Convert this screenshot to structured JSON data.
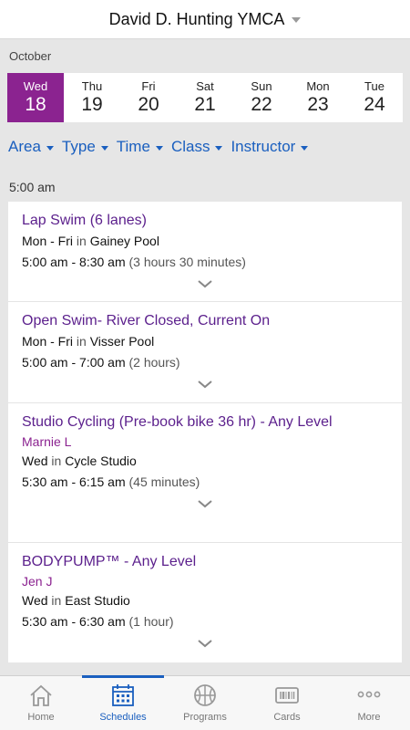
{
  "header": {
    "title": "David D. Hunting YMCA"
  },
  "calendar": {
    "month": "October",
    "days": [
      {
        "name": "Wed",
        "num": "18"
      },
      {
        "name": "Thu",
        "num": "19"
      },
      {
        "name": "Fri",
        "num": "20"
      },
      {
        "name": "Sat",
        "num": "21"
      },
      {
        "name": "Sun",
        "num": "22"
      },
      {
        "name": "Mon",
        "num": "23"
      },
      {
        "name": "Tue",
        "num": "24"
      }
    ],
    "selected_index": 0
  },
  "filters": [
    "Area",
    "Type",
    "Time",
    "Class",
    "Instructor"
  ],
  "section_time": "5:00 am",
  "classes": [
    {
      "name": "Lap Swim (6 lanes)",
      "days": "Mon - Fri",
      "in": " in ",
      "location": "Gainey Pool",
      "time": "5:00 am - 8:30 am",
      "duration": " (3 hours 30 minutes)"
    },
    {
      "name": "Open Swim- River Closed, Current On",
      "days": "Mon - Fri",
      "in": " in ",
      "location": "Visser Pool",
      "time": "5:00 am - 7:00 am",
      "duration": " (2 hours)"
    },
    {
      "name": "Studio Cycling (Pre-book bike 36 hr) - Any Level",
      "instructor": "Marnie L",
      "days": "Wed",
      "in": " in ",
      "location": "Cycle Studio",
      "time": "5:30 am - 6:15 am",
      "duration": " (45 minutes)"
    },
    {
      "name": "BODYPUMP™ - Any Level",
      "instructor": "Jen J",
      "days": "Wed",
      "in": " in ",
      "location": "East Studio",
      "time": "5:30 am - 6:30 am",
      "duration": " (1 hour)"
    }
  ],
  "tabs": [
    {
      "label": "Home",
      "icon": "home-icon"
    },
    {
      "label": "Schedules",
      "icon": "calendar-icon"
    },
    {
      "label": "Programs",
      "icon": "basketball-icon"
    },
    {
      "label": "Cards",
      "icon": "barcode-card-icon"
    },
    {
      "label": "More",
      "icon": "more-dots-icon"
    }
  ],
  "active_tab": "Schedules",
  "colors": {
    "accent_purple": "#8b2390",
    "class_title": "#5b1f8c",
    "link_blue": "#1a5fbf"
  }
}
